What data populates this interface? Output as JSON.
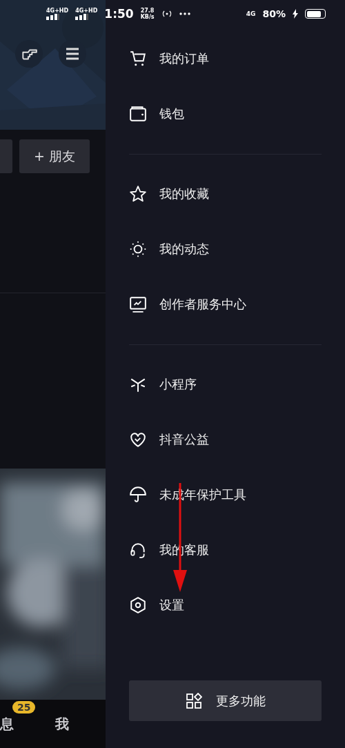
{
  "status_bar": {
    "sim_1": "4G+HD",
    "sim_2": "4G+HD",
    "time": "1:50",
    "speed_value": "27.8",
    "speed_unit": "KB/s",
    "network": "4G",
    "battery": "80%"
  },
  "background_screen": {
    "friend_button": "+ 朋友",
    "tabs": [
      {
        "label": "息",
        "badge": "25"
      },
      {
        "label": "我"
      }
    ]
  },
  "drawer": {
    "groups": [
      [
        {
          "kind": "cart",
          "label": "我的订单"
        },
        {
          "kind": "wallet",
          "label": "钱包"
        }
      ],
      [
        {
          "kind": "star",
          "label": "我的收藏"
        },
        {
          "kind": "sun",
          "label": "我的动态"
        },
        {
          "kind": "monitor",
          "label": "创作者服务中心"
        }
      ],
      [
        {
          "kind": "sparkle",
          "label": "小程序"
        },
        {
          "kind": "heart",
          "label": "抖音公益"
        },
        {
          "kind": "umbrella",
          "label": "未成年保护工具"
        },
        {
          "kind": "headset",
          "label": "我的客服"
        },
        {
          "kind": "hexagon",
          "label": "设置"
        }
      ]
    ],
    "more_button": "更多功能"
  }
}
